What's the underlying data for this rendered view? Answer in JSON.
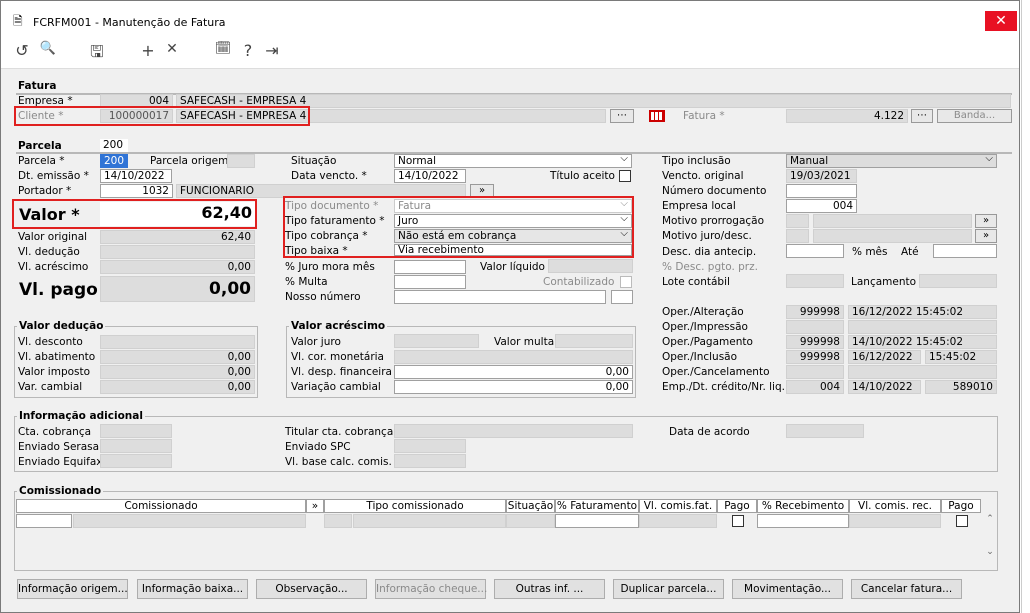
{
  "window": {
    "title": "FCRFM001 - Manutenção de Fatura",
    "close": "✕"
  },
  "toolbar": {
    "undo": "↺",
    "search": "🔍",
    "save": "🖫",
    "add": "+",
    "remove": "✕",
    "calendar": "🗓",
    "help": "?",
    "exit": "⇥"
  },
  "fatura": {
    "header": "Fatura",
    "empresa_label": "Empresa *",
    "empresa_code": "004",
    "empresa_name": "SAFECASH - EMPRESA 4",
    "cliente_label": "Cliente *",
    "cliente_code": "100000017",
    "cliente_name": "SAFECASH - EMPRESA 4",
    "fatura_label": "Fatura *",
    "fatura_value": "4.122",
    "banda_label": "Banda..."
  },
  "parcela": {
    "header": "Parcela",
    "top_value": "200",
    "parcela_label": "Parcela *",
    "parcela_value": "200",
    "origem_label": "Parcela origem",
    "dt_emissao_label": "Dt. emissão *",
    "dt_emissao": "14/10/2022",
    "portador_label": "Portador *",
    "portador_code": "1032",
    "portador_name": "FUNCIONARIO",
    "valor_label": "Valor *",
    "valor": "62,40",
    "valor_original_label": "Valor original",
    "valor_original": "62,40",
    "vl_deducao_label": "Vl. dedução",
    "vl_acrescimo_label": "Vl. acréscimo",
    "vl_acrescimo": "0,00",
    "vl_pago_label": "Vl. pago",
    "vl_pago": "0,00"
  },
  "mid": {
    "situacao_label": "Situação",
    "situacao": "Normal",
    "data_vencto_label": "Data vencto. *",
    "data_vencto": "14/10/2022",
    "titulo_aceito_label": "Título aceito",
    "tipo_doc_label": "Tipo documento *",
    "tipo_doc": "Fatura",
    "tipo_fat_label": "Tipo faturamento *",
    "tipo_fat": "Juro",
    "tipo_cob_label": "Tipo cobrança *",
    "tipo_cob": "Não está em cobrança",
    "tipo_baixa_label": "Tipo baixa *",
    "tipo_baixa": "Via recebimento",
    "juro_mora_label": "% Juro mora mês",
    "valor_liquido_label": "Valor líquido",
    "multa_label": "% Multa",
    "contabilizado_label": "Contabilizado",
    "nosso_numero_label": "Nosso número",
    "dbl": "»"
  },
  "right": {
    "tipo_inclusao_label": "Tipo inclusão",
    "tipo_inclusao": "Manual",
    "vencto_original_label": "Vencto. original",
    "vencto_original": "19/03/2021",
    "numero_doc_label": "Número documento",
    "empresa_local_label": "Empresa local",
    "empresa_local": "004",
    "motivo_prorrog_label": "Motivo prorrogação",
    "motivo_juro_label": "Motivo juro/desc.",
    "desc_antecip_label": "Desc. dia antecip.",
    "pct_mes_label": "% mês",
    "ate_label": "Até",
    "pct_desc_label": "% Desc. pgto. prz.",
    "lote_label": "Lote contábil",
    "lancamento_label": "Lançamento",
    "oper_alt_label": "Oper./Alteração",
    "oper_alt_user": "999998",
    "oper_alt_dt": "16/12/2022 15:45:02",
    "oper_imp_label": "Oper./Impressão",
    "oper_pag_label": "Oper./Pagamento",
    "oper_pag_user": "999998",
    "oper_pag_dt": "14/10/2022 15:45:02",
    "oper_inc_label": "Oper./Inclusão",
    "oper_inc_user": "999998",
    "oper_inc_date": "16/12/2022",
    "oper_inc_time": "15:45:02",
    "oper_canc_label": "Oper./Cancelamento",
    "emp_dt_label": "Emp./Dt. crédito/Nr. liq.",
    "emp_dt_emp": "004",
    "emp_dt_date": "14/10/2022",
    "emp_dt_nr": "589010"
  },
  "deducao": {
    "header": "Valor dedução",
    "desconto_label": "Vl. desconto",
    "abatimento_label": "Vl. abatimento",
    "abatimento": "0,00",
    "imposto_label": "Valor imposto",
    "imposto": "0,00",
    "var_cambial_label": "Var. cambial",
    "var_cambial": "0,00"
  },
  "acrescimo": {
    "header": "Valor acréscimo",
    "juro_label": "Valor juro",
    "multa_label": "Valor multa",
    "cor_label": "Vl. cor. monetária",
    "desp_label": "Vl. desp. financeira",
    "desp": "0,00",
    "var_label": "Variação cambial",
    "var": "0,00"
  },
  "info": {
    "header": "Informação adicional",
    "cta_label": "Cta. cobrança",
    "serasa_label": "Enviado Serasa",
    "equifax_label": "Enviado Equifax",
    "titular_label": "Titular cta. cobrança",
    "spc_label": "Enviado SPC",
    "base_label": "Vl. base calc. comis.",
    "acordo_label": "Data de acordo"
  },
  "comis": {
    "header": "Comissionado",
    "columns": [
      "Comissionado",
      "»",
      "Tipo comissionado",
      "Situação",
      "% Faturamento",
      "Vl. comis.fat.",
      "Pago",
      "% Recebimento",
      "Vl. comis. rec.",
      "Pago"
    ]
  },
  "buttons": [
    "Informação origem...",
    "Informação baixa...",
    "Observação...",
    "Informação cheque...",
    "Outras inf. ...",
    "Duplicar parcela...",
    "Movimentação...",
    "Cancelar fatura..."
  ]
}
